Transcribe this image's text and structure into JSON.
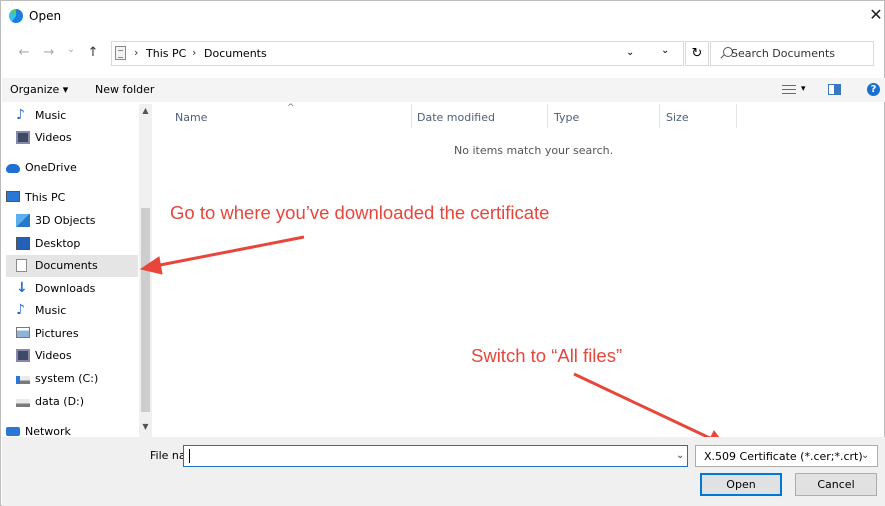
{
  "window": {
    "title": "Open",
    "close_glyph": "✕"
  },
  "toolbar": {
    "back_glyph": "←",
    "forward_glyph": "→",
    "recent_glyph": "⌄",
    "up_glyph": "↑",
    "breadcrumbs": [
      "This PC",
      "Documents"
    ],
    "breadcrumb_separator": "›",
    "address_dropdown_glyph": "⌄",
    "refresh_glyph": "↻",
    "search_placeholder": "Search Documents"
  },
  "commandbar": {
    "organize_label": "Organize ▾",
    "new_folder_label": "New folder",
    "views_caret": "▾",
    "help_glyph": "?"
  },
  "sidebar": {
    "items": [
      {
        "label": "Music",
        "icon": "music-icon"
      },
      {
        "label": "Videos",
        "icon": "videos-icon"
      },
      {
        "label": "OneDrive",
        "icon": "onedrive-icon"
      },
      {
        "label": "This PC",
        "icon": "this-pc-icon"
      },
      {
        "label": "3D Objects",
        "icon": "3d-objects-icon"
      },
      {
        "label": "Desktop",
        "icon": "desktop-icon"
      },
      {
        "label": "Documents",
        "icon": "documents-icon",
        "selected": true
      },
      {
        "label": "Downloads",
        "icon": "downloads-icon"
      },
      {
        "label": "Music",
        "icon": "music-icon"
      },
      {
        "label": "Pictures",
        "icon": "pictures-icon"
      },
      {
        "label": "Videos",
        "icon": "videos-icon"
      },
      {
        "label": "system (C:)",
        "icon": "system-drive-icon"
      },
      {
        "label": "data (D:)",
        "icon": "drive-icon"
      },
      {
        "label": "Network",
        "icon": "network-icon"
      }
    ],
    "scroll_up_glyph": "▲",
    "scroll_down_glyph": "▼"
  },
  "filelist": {
    "columns": [
      "Name",
      "Date modified",
      "Type",
      "Size"
    ],
    "sort_glyph": "^",
    "empty_message": "No items match your search."
  },
  "annotations": {
    "sidebar_hint": "Go to where you’ve downloaded the certificate",
    "filter_hint": "Switch to “All files”",
    "color": "#e8453b"
  },
  "footer": {
    "file_name_label": "File name:",
    "file_name_value": "",
    "file_name_dropdown_glyph": "⌄",
    "file_type_filter": "X.509 Certificate (*.cer;*.crt)",
    "file_type_dropdown_glyph": "⌄",
    "open_label": "Open",
    "cancel_label": "Cancel"
  },
  "colors": {
    "selection": "#e5e5e5",
    "accent": "#0078d7",
    "header_text": "#4c607a"
  }
}
